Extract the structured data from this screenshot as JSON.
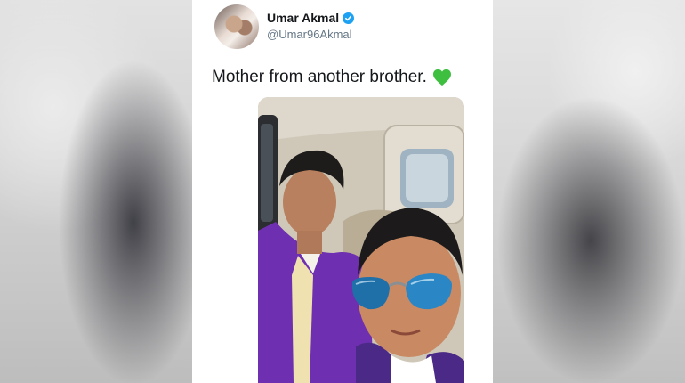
{
  "tweet": {
    "author_name": "Umar Akmal",
    "handle": "@Umar96Akmal",
    "text": "Mother from another brother.",
    "emoji_icon": "green-heart-icon",
    "verified": true
  },
  "colors": {
    "verified_badge": "#1da1f2",
    "heart": "#3fbf3f",
    "text": "#14171a",
    "handle": "#657786"
  }
}
